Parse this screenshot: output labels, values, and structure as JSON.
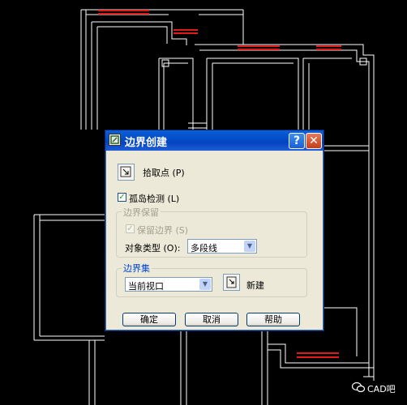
{
  "dialog": {
    "title": "边界创建",
    "title_buttons": {
      "help": "?",
      "close": "✕"
    },
    "pick_point_label": "拾取点 (P)",
    "island_detection": {
      "label": "孤岛检测 (L)",
      "checked": true
    },
    "boundary_retention": {
      "group_title": "边界保留",
      "retain_label": "保留边界 (S)",
      "retain_checked": true,
      "object_type_label": "对象类型 (O):",
      "object_type_value": "多段线"
    },
    "boundary_set": {
      "group_title": "边界集",
      "value": "当前视口",
      "new_label": "新建"
    },
    "buttons": {
      "ok": "确定",
      "cancel": "取消",
      "help": "帮助"
    }
  },
  "watermark": {
    "text": "CAD吧",
    "icon": "wechat-icon"
  },
  "colors": {
    "background": "#000000",
    "lines": "#ffffff",
    "openings": "#e11a1a",
    "dialog": "#ece9d8",
    "titlebar": "#0a5fd8"
  }
}
